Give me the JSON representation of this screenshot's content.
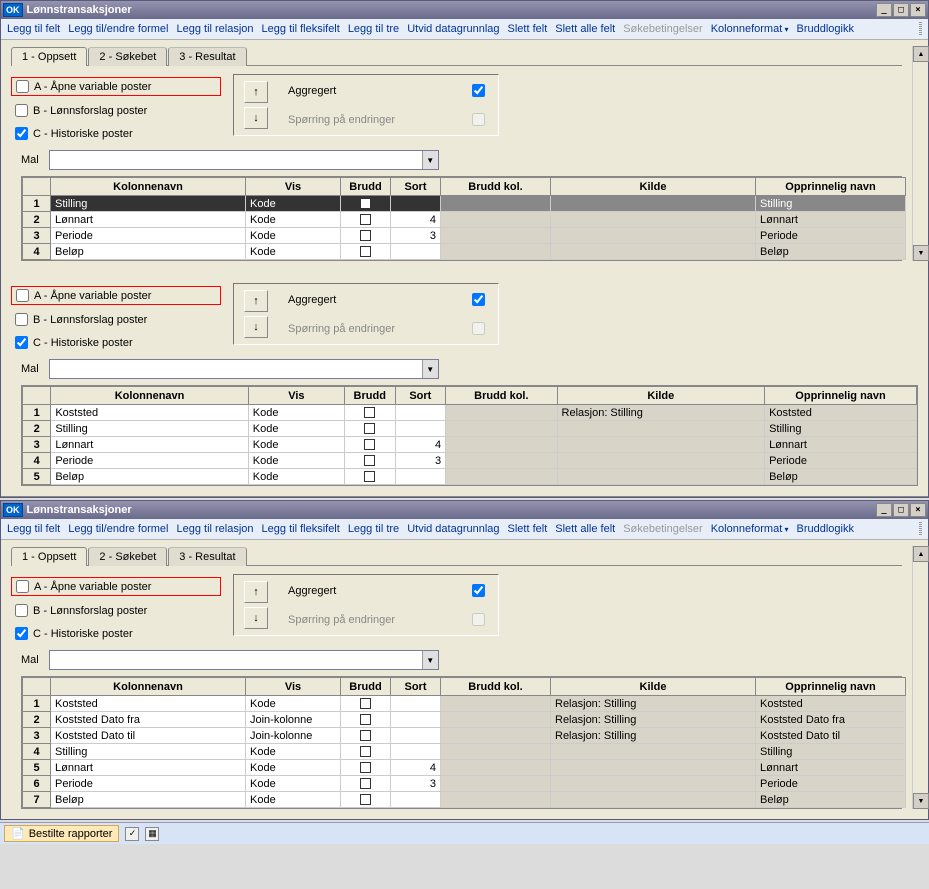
{
  "window_title": "Lønnstransaksjoner",
  "toolbar": [
    {
      "label": "Legg til felt",
      "disabled": false
    },
    {
      "label": "Legg til/endre formel",
      "disabled": false
    },
    {
      "label": "Legg til relasjon",
      "disabled": false
    },
    {
      "label": "Legg til fleksifelt",
      "disabled": false
    },
    {
      "label": "Legg til tre",
      "disabled": false
    },
    {
      "label": "Utvid datagrunnlag",
      "disabled": false
    },
    {
      "label": "Slett felt",
      "disabled": false
    },
    {
      "label": "Slett alle felt",
      "disabled": false
    },
    {
      "label": "Søkebetingelser",
      "disabled": true
    },
    {
      "label": "Kolonneformat",
      "disabled": false,
      "dropdown": true
    },
    {
      "label": "Bruddlogikk",
      "disabled": false
    }
  ],
  "tabs": [
    "1 - Oppsett",
    "2 - Søkebet",
    "3 - Resultat"
  ],
  "checks": {
    "a": "A - Åpne variable poster",
    "b": "B - Lønnsforslag poster",
    "c": "C - Historiske poster"
  },
  "agg_panel": {
    "aggregert": "Aggregert",
    "sporring": "Spørring på endringer"
  },
  "mal_label": "Mal",
  "grid_headers": {
    "kolonnenavn": "Kolonnenavn",
    "vis": "Vis",
    "brudd": "Brudd",
    "sort": "Sort",
    "bruddkol": "Brudd kol.",
    "kilde": "Kilde",
    "opprinnelig": "Opprinnelig navn"
  },
  "grid1": [
    {
      "n": "1",
      "kol": "Stilling",
      "vis": "Kode",
      "brudd": false,
      "sort": "",
      "kilde": "",
      "opp": "Stilling",
      "selected": true
    },
    {
      "n": "2",
      "kol": "Lønnart",
      "vis": "Kode",
      "brudd": false,
      "sort": "4",
      "kilde": "",
      "opp": "Lønnart"
    },
    {
      "n": "3",
      "kol": "Periode",
      "vis": "Kode",
      "brudd": false,
      "sort": "3",
      "kilde": "",
      "opp": "Periode"
    },
    {
      "n": "4",
      "kol": "Beløp",
      "vis": "Kode",
      "brudd": false,
      "sort": "",
      "kilde": "",
      "opp": "Beløp"
    }
  ],
  "grid2": [
    {
      "n": "1",
      "kol": "Koststed",
      "vis": "Kode",
      "brudd": false,
      "sort": "",
      "kilde": "Relasjon: Stilling",
      "opp": "Koststed"
    },
    {
      "n": "2",
      "kol": "Stilling",
      "vis": "Kode",
      "brudd": false,
      "sort": "",
      "kilde": "",
      "opp": "Stilling"
    },
    {
      "n": "3",
      "kol": "Lønnart",
      "vis": "Kode",
      "brudd": false,
      "sort": "4",
      "kilde": "",
      "opp": "Lønnart"
    },
    {
      "n": "4",
      "kol": "Periode",
      "vis": "Kode",
      "brudd": false,
      "sort": "3",
      "kilde": "",
      "opp": "Periode"
    },
    {
      "n": "5",
      "kol": "Beløp",
      "vis": "Kode",
      "brudd": false,
      "sort": "",
      "kilde": "",
      "opp": "Beløp"
    }
  ],
  "grid3": [
    {
      "n": "1",
      "kol": "Koststed",
      "vis": "Kode",
      "brudd": false,
      "sort": "",
      "kilde": "Relasjon: Stilling",
      "opp": "Koststed"
    },
    {
      "n": "2",
      "kol": "Koststed Dato fra",
      "vis": "Join-kolonne",
      "brudd": false,
      "sort": "",
      "kilde": "Relasjon: Stilling",
      "opp": "Koststed Dato fra"
    },
    {
      "n": "3",
      "kol": "Koststed Dato til",
      "vis": "Join-kolonne",
      "brudd": false,
      "sort": "",
      "kilde": "Relasjon: Stilling",
      "opp": "Koststed Dato til"
    },
    {
      "n": "4",
      "kol": "Stilling",
      "vis": "Kode",
      "brudd": false,
      "sort": "",
      "kilde": "",
      "opp": "Stilling"
    },
    {
      "n": "5",
      "kol": "Lønnart",
      "vis": "Kode",
      "brudd": false,
      "sort": "4",
      "kilde": "",
      "opp": "Lønnart"
    },
    {
      "n": "6",
      "kol": "Periode",
      "vis": "Kode",
      "brudd": false,
      "sort": "3",
      "kilde": "",
      "opp": "Periode"
    },
    {
      "n": "7",
      "kol": "Beløp",
      "vis": "Kode",
      "brudd": false,
      "sort": "",
      "kilde": "",
      "opp": "Beløp"
    }
  ],
  "taskbar": {
    "btn": "Bestilte rapporter"
  }
}
